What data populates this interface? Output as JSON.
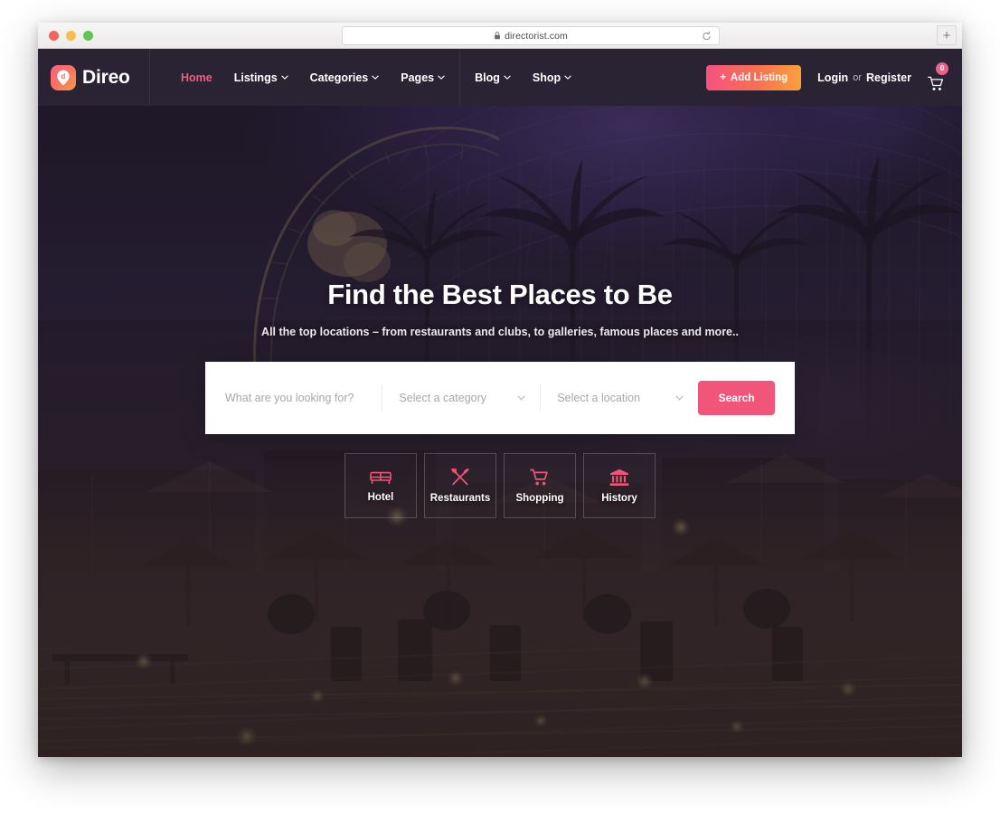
{
  "browser": {
    "url": "directorist.com",
    "lock_icon": "lock-icon",
    "reload_icon": "reload-icon",
    "newtab_label": "+",
    "traffic_lights": [
      "close-red",
      "minimize-yellow",
      "maximize-green"
    ]
  },
  "header": {
    "brand": {
      "name": "Direo",
      "mark_icon": "map-pin-logo-icon",
      "gradient_from": "#f95f8c",
      "gradient_to": "#f99a4b"
    },
    "nav": [
      {
        "label": "Home",
        "active": true,
        "caret": false
      },
      {
        "label": "Listings",
        "active": false,
        "caret": true
      },
      {
        "label": "Categories",
        "active": false,
        "caret": true
      },
      {
        "label": "Pages",
        "active": false,
        "caret": true
      },
      {
        "label": "Blog",
        "active": false,
        "caret": true
      },
      {
        "label": "Shop",
        "active": false,
        "caret": true
      }
    ],
    "add_listing": {
      "label": "Add Listing",
      "plus": "+"
    },
    "auth": {
      "login": "Login",
      "or": "or",
      "register": "Register"
    },
    "cart": {
      "icon": "shopping-cart-icon",
      "count": "0",
      "badge_color": "#e8628a"
    },
    "active_color": "#f25d7f",
    "background": "#2a2333"
  },
  "hero": {
    "title": "Find the Best Places to Be",
    "subtitle": "All the top locations – from restaurants and clubs, to galleries, famous places and more.."
  },
  "search": {
    "keyword_placeholder": "What are you looking for?",
    "category_placeholder": "Select a category",
    "location_placeholder": "Select a location",
    "button_label": "Search",
    "button_color": "#f1557a",
    "caret_icon": "chevron-down-icon"
  },
  "categories": [
    {
      "label": "Hotel",
      "icon": "bed-icon"
    },
    {
      "label": "Restaurants",
      "icon": "restaurant-cutlery-icon"
    },
    {
      "label": "Shopping",
      "icon": "shopping-cart-icon"
    },
    {
      "label": "History",
      "icon": "museum-bank-icon"
    }
  ]
}
